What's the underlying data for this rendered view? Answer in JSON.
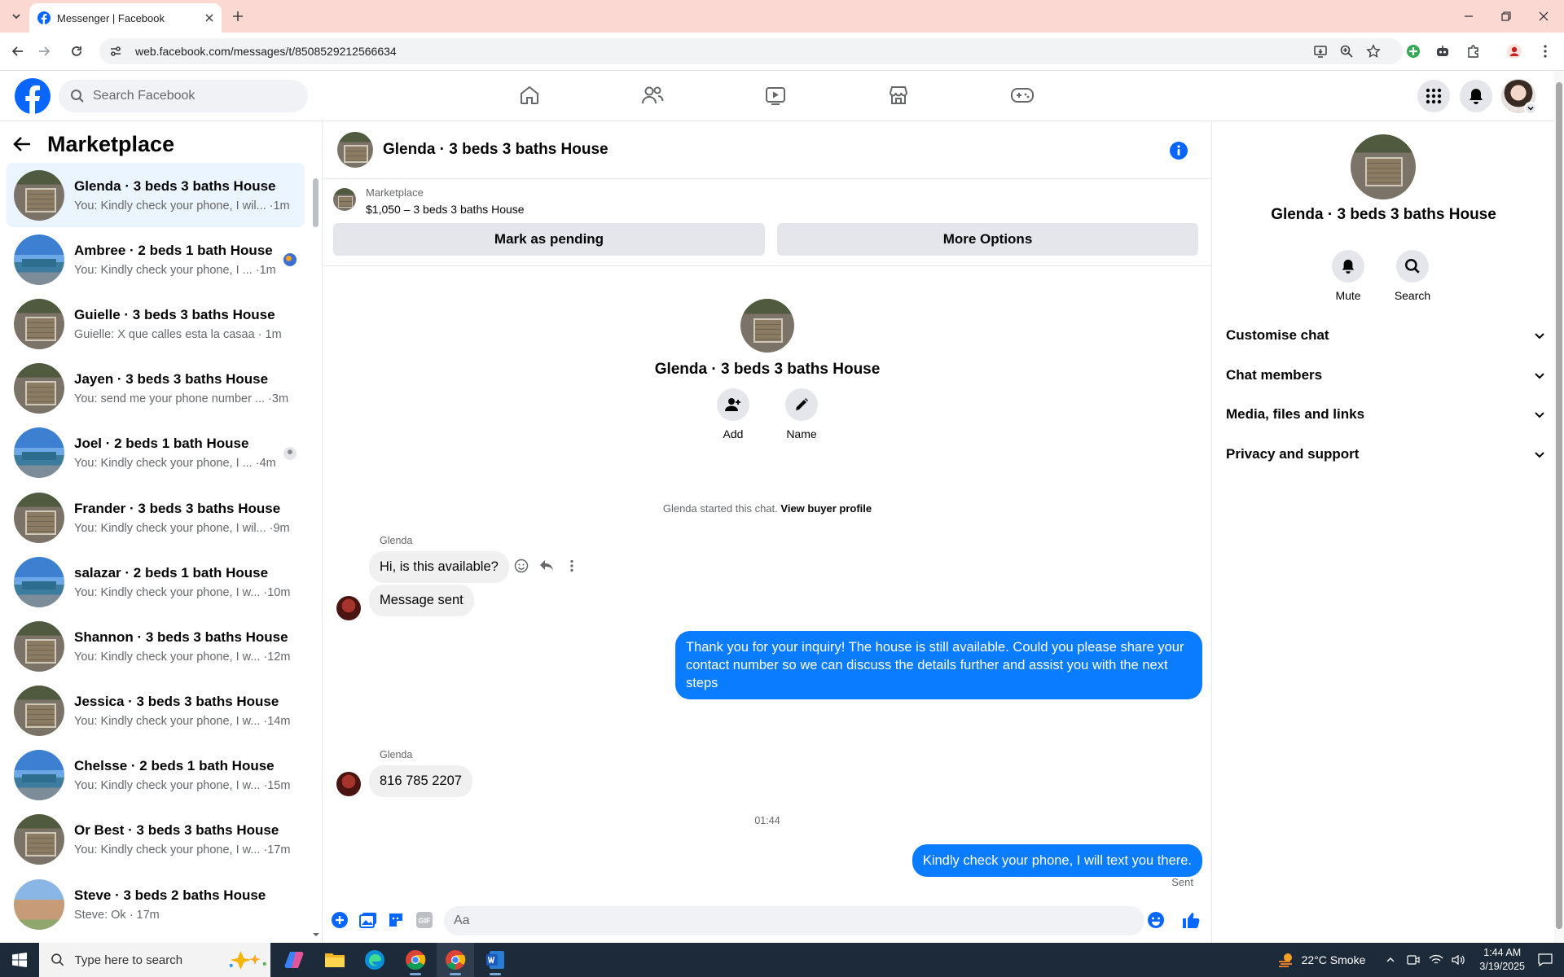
{
  "browser": {
    "tab_title": "Messenger | Facebook",
    "url": "web.facebook.com/messages/t/8508529212566634"
  },
  "fb": {
    "search_placeholder": "Search Facebook"
  },
  "sidebar": {
    "title": "Marketplace",
    "chats": [
      {
        "name": "Glenda · 3 beds 3 baths House",
        "preview": "You: Kindly check your phone, I wil... ·1m",
        "avatar": "garage",
        "active": true
      },
      {
        "name": "Ambree · 2 beds 1 bath House",
        "preview": "You: Kindly check your phone, I ... ·1m",
        "avatar": "pool",
        "receipt": "blue"
      },
      {
        "name": "Guielle · 3 beds 3 baths House",
        "preview": "Guielle: X que calles esta la casaa · 1m",
        "avatar": "garage"
      },
      {
        "name": "Jayen · 3 beds 3 baths House",
        "preview": "You: send me your phone number ... ·3m",
        "avatar": "garage"
      },
      {
        "name": "Joel · 2 beds 1 bath House",
        "preview": "You: Kindly check your phone, I ... ·4m",
        "avatar": "pool",
        "receipt": "grey"
      },
      {
        "name": "Frander · 3 beds 3 baths House",
        "preview": "You: Kindly check your phone, I wil... ·9m",
        "avatar": "garage"
      },
      {
        "name": "salazar · 2 beds 1 bath House",
        "preview": "You: Kindly check your phone, I w... ·10m",
        "avatar": "pool"
      },
      {
        "name": "Shannon · 3 beds 3 baths House",
        "preview": "You: Kindly check your phone, I w... ·12m",
        "avatar": "garage"
      },
      {
        "name": "Jessica · 3 beds 3 baths House",
        "preview": "You: Kindly check your phone, I w... ·14m",
        "avatar": "garage"
      },
      {
        "name": "Chelsse · 2 beds 1 bath House",
        "preview": "You: Kindly check your phone, I w... ·15m",
        "avatar": "pool"
      },
      {
        "name": "Or Best · 3 beds 3 baths House",
        "preview": "You: Kindly check your phone, I w... ·17m",
        "avatar": "garage"
      },
      {
        "name": "Steve · 3 beds 2 baths House",
        "preview": "Steve: Ok · 17m",
        "avatar": "brick"
      }
    ]
  },
  "chat": {
    "title": "Glenda · 3 beds 3 baths House",
    "listing_label": "Marketplace",
    "listing_price": "$1,050 – 3 beds 3 baths House",
    "mark_pending_label": "Mark as pending",
    "more_options_label": "More Options",
    "intro_name": "Glenda · 3 beds 3 baths House",
    "add_label": "Add",
    "name_label": "Name",
    "started_text": "Glenda started this chat.",
    "view_profile_label": "View buyer profile",
    "sender1": "Glenda",
    "msg1": "Hi, is this available?",
    "msg2": "Message sent",
    "msg3": "Thank you for your inquiry! The house is still available. Could you please share your contact number so we can discuss the details further and assist you with the next steps",
    "sender2": "Glenda",
    "msg4": "816 785 2207",
    "timestamp": "01:44",
    "msg5": "Kindly check your phone, I will text you there.",
    "sent_label": "Sent",
    "input_placeholder": "Aa"
  },
  "details": {
    "name": "Glenda · 3 beds 3 baths House",
    "mute_label": "Mute",
    "search_label": "Search",
    "sections": [
      "Customise chat",
      "Chat members",
      "Media, files and links",
      "Privacy and support"
    ]
  },
  "taskbar": {
    "search_placeholder": "Type here to search",
    "weather": "22°C  Smoke",
    "time": "1:44 AM",
    "date": "3/19/2025"
  },
  "colors": {
    "accent": "#0a7cff",
    "fb_blue": "#0866ff",
    "tab_bar": "#fbd8d2",
    "active_chat_bg": "#ebf5ff"
  }
}
